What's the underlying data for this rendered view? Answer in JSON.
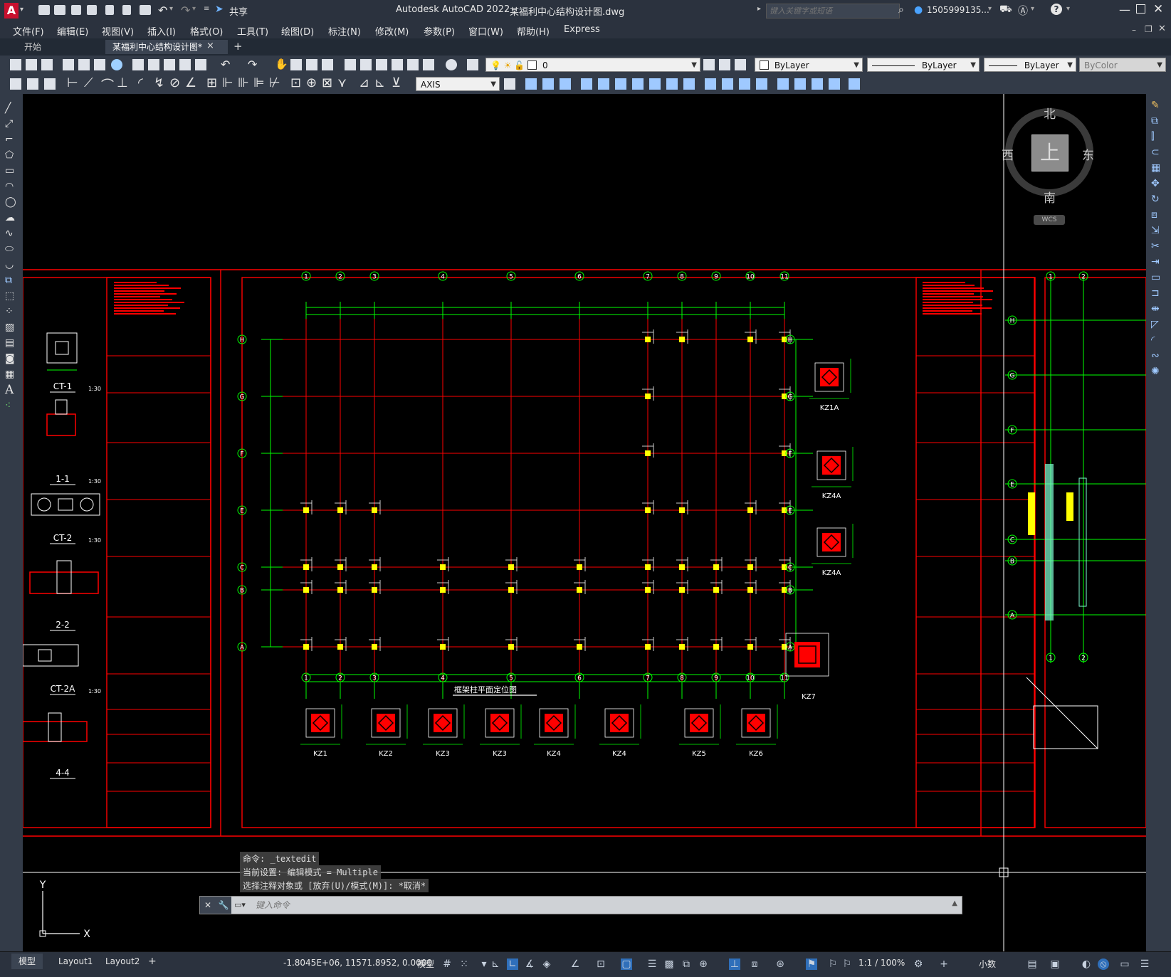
{
  "titlebar": {
    "app_title": "Autodesk AutoCAD 2022",
    "file_title": "某福利中心结构设计图.dwg",
    "share_label": "共享",
    "search_placeholder": "键入关键字或短语",
    "user": "1505999135...",
    "logo": "A"
  },
  "menubar": {
    "items": [
      "文件(F)",
      "编辑(E)",
      "视图(V)",
      "插入(I)",
      "格式(O)",
      "工具(T)",
      "绘图(D)",
      "标注(N)",
      "修改(M)",
      "参数(P)",
      "窗口(W)",
      "帮助(H)",
      "Express"
    ]
  },
  "tabs": {
    "start": "开始",
    "document": "某福利中心结构设计图*",
    "close": "×",
    "add": "+"
  },
  "toolbar": {
    "layer_value": "0",
    "color_value": "ByLayer",
    "linetype_value": "ByLayer",
    "lineweight_value": "ByLayer",
    "plotstyle_value": "ByColor",
    "dimstyle_value": "AXIS"
  },
  "viewcube": {
    "north": "北",
    "south": "南",
    "east": "东",
    "west": "西",
    "top": "上",
    "wcs": "WCS"
  },
  "drawing": {
    "plan_title": "框架柱平面定位图",
    "grid_top": [
      "1",
      "2",
      "3",
      "4",
      "5",
      "6",
      "7",
      "8",
      "9",
      "10",
      "11"
    ],
    "grid_left": [
      "H",
      "G",
      "F",
      "E",
      "C",
      "B",
      "A"
    ],
    "right_details": [
      "KZ1A",
      "KZ4A",
      "KZ4A",
      "KZ7"
    ],
    "bottom_details": [
      "KZ1",
      "KZ2",
      "KZ3",
      "KZ3",
      "KZ4",
      "KZ4",
      "KZ5",
      "KZ6"
    ],
    "left_sections": [
      {
        "name": "CT-1",
        "scale": "1:30"
      },
      {
        "name": "1-1",
        "scale": "1:30"
      },
      {
        "name": "CT-2",
        "scale": "1:30"
      },
      {
        "name": "2-2",
        "scale": ""
      },
      {
        "name": "CT-2A",
        "scale": "1:30"
      },
      {
        "name": "4-4",
        "scale": ""
      }
    ],
    "right_partial_grid_left": [
      "H",
      "G",
      "F",
      "E",
      "C",
      "B",
      "A"
    ],
    "right_partial_grid_top": [
      "1",
      "2"
    ],
    "ucs_x": "X",
    "ucs_y": "Y"
  },
  "commandline": {
    "history": [
      "命令: _textedit",
      "当前设置: 编辑模式 = Multiple",
      "选择注释对象或 [放弃(U)/模式(M)]: *取消*"
    ],
    "placeholder": "键入命令"
  },
  "statusbar": {
    "layout_tabs": [
      "模型",
      "Layout1",
      "Layout2"
    ],
    "add": "+",
    "coordinates": "-1.8045E+06, 11571.8952, 0.0000",
    "model_label": "模型",
    "scale": "1:1 / 100%",
    "units": "小数"
  },
  "colors": {
    "cad_background": "#000000",
    "frame_red": "#ff0000",
    "grid_green": "#00ff00",
    "column_yellow": "#ffff00",
    "ui_dark": "#2b323e"
  }
}
